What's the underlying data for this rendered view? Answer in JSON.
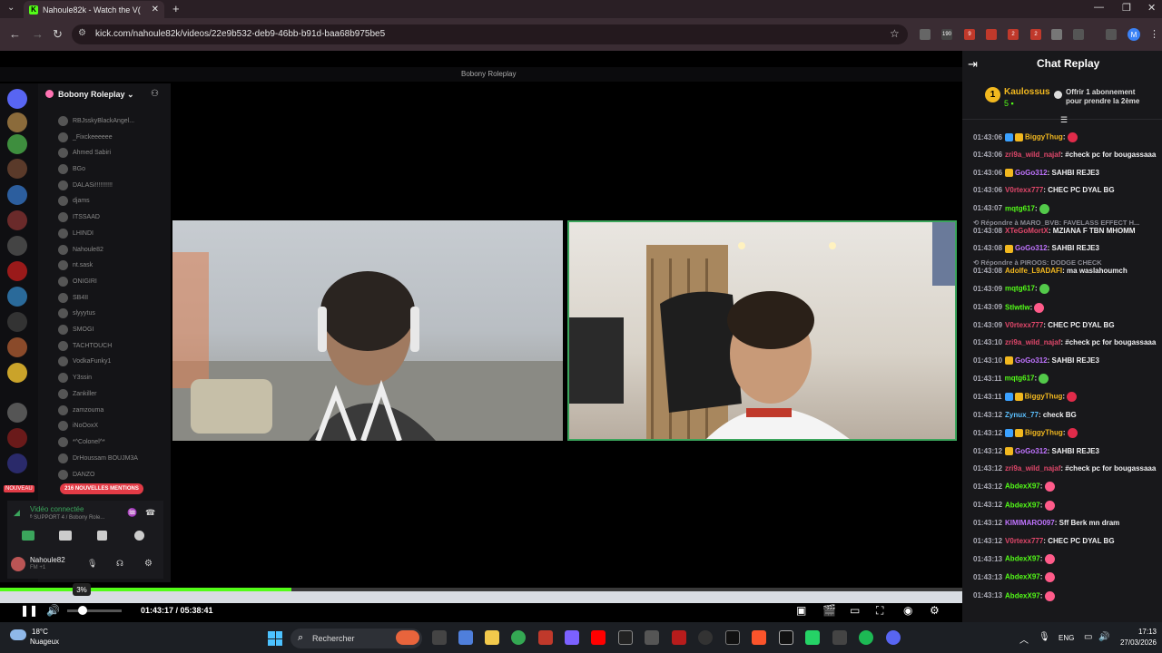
{
  "browser": {
    "tab_title": "Nahoule82k - Watch the V(",
    "url": "kick.com/nahoule82k/videos/22e9b532-deb9-46bb-b91d-baa68b975be5",
    "ext_badges": [
      "190",
      "9",
      "2",
      "2"
    ],
    "profile_letter": "M"
  },
  "discord": {
    "window_title": "Bobony Roleplay",
    "server_name": "Bobony Roleplay",
    "members": [
      "RBJsskyBlackAngel...",
      "_Fixckeeeeee",
      "Ahmed Sabiri",
      "BGo",
      "DALASi!!!!!!!!!!",
      "djams",
      "ITSSAAD",
      "LHINDI",
      "Nahoule82",
      "nt.sask",
      "ONIGIRI",
      "SB4II",
      "slyyytus",
      "SMOGI",
      "TACHTOUCH",
      "VodkaFunky1",
      "Y3ssin",
      "Zankiller",
      "zamzouma",
      "iNoOoxX",
      "*^Colonel^*",
      "DrHoussam BOUJM3A",
      "DANZO"
    ],
    "mentions": "216 NOUVELLES MENTIONS",
    "nouveau": "NOUVEAU",
    "voice_status": "Vidéo connectée",
    "voice_sub": "ᴮ SUPPORT 4 / Bobony Role...",
    "user_name": "Nahoule82",
    "user_sub": "FM +1"
  },
  "player": {
    "volume_tip": "3%",
    "progress_fraction": 0.303,
    "timecode": "01:43:17 / 05:38:41"
  },
  "chat": {
    "title": "Chat Replay",
    "gift_rank": "1",
    "gift_user": "Kaulossus",
    "gift_count": "5",
    "gift_text": "Offrir 1 abonnement pour prendre la 2ème",
    "messages": [
      {
        "ts": "01:43:06",
        "user": "BiggyThug",
        "color": "#f2b81f",
        "body": "",
        "badges": [
          "#3ba1ff",
          "#f2b81f"
        ],
        "emote": "#e02b4a"
      },
      {
        "ts": "01:43:06",
        "user": "zri9a_wild_najaf",
        "color": "#e0476a",
        "body": "#check pc for bougassaaa",
        "badges": [],
        "emote": ""
      },
      {
        "ts": "01:43:06",
        "user": "GoGo312",
        "color": "#c074ff",
        "body": "SAHBI REJE3",
        "badges": [
          "#f2b81f"
        ],
        "emote": ""
      },
      {
        "ts": "01:43:06",
        "user": "V0rtexx777",
        "color": "#e0476a",
        "body": "CHEC PC DYAL BG",
        "badges": [],
        "emote": ""
      },
      {
        "ts": "01:43:07",
        "user": "mqtg617",
        "color": "#53fc18",
        "body": "",
        "badges": [],
        "emote": "#53c94a"
      },
      {
        "reply": "⟲ Répondre à MARO_BVB: FAVELASS EFFECT H...",
        "ts": "01:43:08",
        "user": "XTeGoMortX",
        "color": "#e0476a",
        "body": "MZIANA F TBN MHOMM",
        "badges": [],
        "emote": ""
      },
      {
        "ts": "01:43:08",
        "user": "GoGo312",
        "color": "#c074ff",
        "body": "SAHBI REJE3",
        "badges": [
          "#f2b81f"
        ],
        "emote": ""
      },
      {
        "reply": "⟲ Répondre à PIROOS: DODGE CHECK",
        "ts": "01:43:08",
        "user": "Adolfe_L9ADAFI",
        "color": "#f2b81f",
        "body": "ma waslahoumch",
        "badges": [],
        "emote": ""
      },
      {
        "ts": "01:43:09",
        "user": "mqtg617",
        "color": "#53fc18",
        "body": "",
        "badges": [],
        "emote": "#53c94a"
      },
      {
        "ts": "01:43:09",
        "user": "Stlwtlw",
        "color": "#53fc18",
        "body": "",
        "badges": [],
        "emote": "#ff5b8a"
      },
      {
        "ts": "01:43:09",
        "user": "V0rtexx777",
        "color": "#e0476a",
        "body": "CHEC PC DYAL BG",
        "badges": [],
        "emote": ""
      },
      {
        "ts": "01:43:10",
        "user": "zri9a_wild_najaf",
        "color": "#e0476a",
        "body": "#check pc for bougassaaa",
        "badges": [],
        "emote": ""
      },
      {
        "ts": "01:43:10",
        "user": "GoGo312",
        "color": "#c074ff",
        "body": "SAHBI REJE3",
        "badges": [
          "#f2b81f"
        ],
        "emote": ""
      },
      {
        "ts": "01:43:11",
        "user": "mqtg617",
        "color": "#53fc18",
        "body": "",
        "badges": [],
        "emote": "#53c94a"
      },
      {
        "ts": "01:43:11",
        "user": "BiggyThug",
        "color": "#f2b81f",
        "body": "",
        "badges": [
          "#3ba1ff",
          "#f2b81f"
        ],
        "emote": "#e02b4a"
      },
      {
        "ts": "01:43:12",
        "user": "Zynux_77",
        "color": "#5bc0ff",
        "body": "check BG",
        "badges": [],
        "emote": ""
      },
      {
        "ts": "01:43:12",
        "user": "BiggyThug",
        "color": "#f2b81f",
        "body": "",
        "badges": [
          "#3ba1ff",
          "#f2b81f"
        ],
        "emote": "#e02b4a"
      },
      {
        "ts": "01:43:12",
        "user": "GoGo312",
        "color": "#c074ff",
        "body": "SAHBI REJE3",
        "badges": [
          "#f2b81f"
        ],
        "emote": ""
      },
      {
        "ts": "01:43:12",
        "user": "zri9a_wild_najaf",
        "color": "#e0476a",
        "body": "#check pc for bougassaaa",
        "badges": [],
        "emote": ""
      },
      {
        "ts": "01:43:12",
        "user": "AbdexX97",
        "color": "#53fc18",
        "body": "",
        "badges": [],
        "emote": "#ff5b8a"
      },
      {
        "ts": "01:43:12",
        "user": "AbdexX97",
        "color": "#53fc18",
        "body": "",
        "badges": [],
        "emote": "#ff5b8a"
      },
      {
        "ts": "01:43:12",
        "user": "KIMIMARO097",
        "color": "#c074ff",
        "body": "Sff Berk mn dram",
        "badges": [],
        "emote": ""
      },
      {
        "ts": "01:43:12",
        "user": "V0rtexx777",
        "color": "#e0476a",
        "body": "CHEC PC DYAL BG",
        "badges": [],
        "emote": ""
      },
      {
        "ts": "01:43:13",
        "user": "AbdexX97",
        "color": "#53fc18",
        "body": "",
        "badges": [],
        "emote": "#ff5b8a"
      },
      {
        "ts": "01:43:13",
        "user": "AbdexX97",
        "color": "#53fc18",
        "body": "",
        "badges": [],
        "emote": "#ff5b8a"
      },
      {
        "ts": "01:43:13",
        "user": "AbdexX97",
        "color": "#53fc18",
        "body": "",
        "badges": [],
        "emote": "#ff5b8a"
      }
    ]
  },
  "taskbar": {
    "temp": "18°C",
    "weather": "Nuageux",
    "search": "Rechercher",
    "lang": "ENG",
    "time": "17:13",
    "date": "27/03/2026"
  },
  "colors": {
    "accent": "#53fc18",
    "chat_bg": "#18181b",
    "browser_chrome": "#3a2c33"
  }
}
